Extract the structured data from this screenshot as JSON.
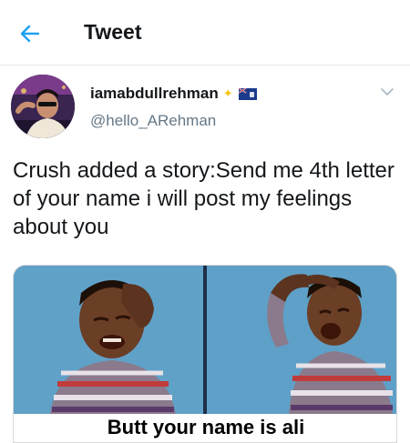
{
  "header": {
    "back_icon": "arrow-left-icon",
    "title": "Tweet",
    "accent_color": "#1da1f2"
  },
  "author": {
    "display_name": "iamabdullrehman",
    "handle": "@hello_ARehman",
    "badges": [
      "sparkle-icon",
      "flag-icon"
    ]
  },
  "tweet": {
    "text": "Crush added a story:Send me 4th letter of your name i will post my feelings about you"
  },
  "media": {
    "caption": "Butt your name is ali"
  }
}
